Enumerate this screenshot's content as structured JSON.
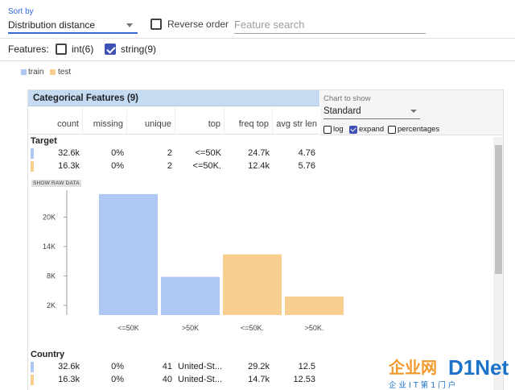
{
  "sort": {
    "label": "Sort by",
    "value": "Distribution distance"
  },
  "reverse_order": {
    "label": "Reverse order",
    "checked": false
  },
  "search": {
    "placeholder": "Feature search"
  },
  "features_filter": {
    "label": "Features:",
    "int": {
      "label": "int(6)",
      "checked": false
    },
    "string": {
      "label": "string(9)",
      "checked": true
    }
  },
  "legend": [
    {
      "name": "train",
      "color": "#aec7f3"
    },
    {
      "name": "test",
      "color": "#f8cf8e"
    }
  ],
  "panel": {
    "title": "Categorical Features (9)",
    "columns": [
      "count",
      "missing",
      "unique",
      "top",
      "freq top",
      "avg str len"
    ]
  },
  "chart_controls": {
    "label": "Chart to show",
    "value": "Standard",
    "options": [
      {
        "label": "log",
        "checked": false
      },
      {
        "label": "expand",
        "checked": true
      },
      {
        "label": "percentages",
        "checked": false
      }
    ]
  },
  "raw_data_label": "SHOW RAW DATA",
  "features": [
    {
      "name": "Target",
      "rows": [
        {
          "series": "train",
          "count": "32.6k",
          "missing": "0%",
          "unique": "2",
          "top": "<=50K",
          "freq_top": "24.7k",
          "avg_str_len": "4.76"
        },
        {
          "series": "test",
          "count": "16.3k",
          "missing": "0%",
          "unique": "2",
          "top": "<=50K.",
          "freq_top": "12.4k",
          "avg_str_len": "5.76"
        }
      ]
    },
    {
      "name": "Country",
      "rows": [
        {
          "series": "train",
          "count": "32.6k",
          "missing": "0%",
          "unique": "41",
          "top": "United-St...",
          "freq_top": "29.2k",
          "avg_str_len": "12.5"
        },
        {
          "series": "test",
          "count": "16.3k",
          "missing": "0%",
          "unique": "40",
          "top": "United-St...",
          "freq_top": "14.7k",
          "avg_str_len": "12.53"
        }
      ]
    }
  ],
  "chart_data": {
    "type": "bar",
    "categories": [
      "<=50K",
      ">50K",
      "<=50K.",
      ">50K."
    ],
    "values": [
      24700,
      7800,
      12400,
      3800
    ],
    "bar_colors": [
      "#aec7f3",
      "#aec7f3",
      "#f8cf8e",
      "#f8cf8e"
    ],
    "title": "",
    "xlabel": "",
    "ylabel": "",
    "y_ticks": [
      2000,
      8000,
      14000,
      20000
    ],
    "y_tick_labels": [
      "2K",
      "8K",
      "14K",
      "20K"
    ],
    "ylim": [
      0,
      25500
    ]
  },
  "watermark": {
    "brand": "企业网",
    "logo": "D1Net",
    "slogan": "企 业 I T 第 1 门 户"
  }
}
